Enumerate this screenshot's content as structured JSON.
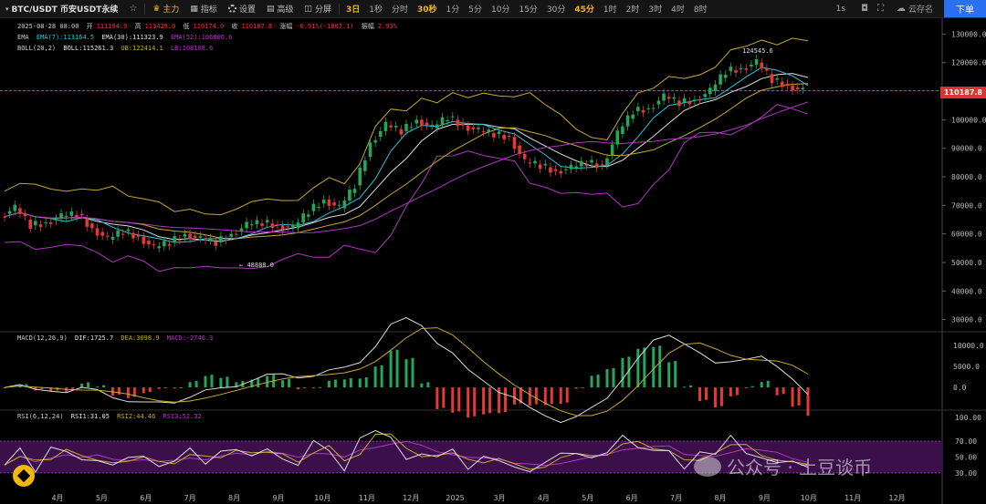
{
  "toolbar": {
    "symbol": "BTC/USDT 币安USDT永续",
    "items": [
      "主力",
      "指标",
      "设置",
      "高级",
      "分屏"
    ],
    "timeframes": [
      "3日",
      "1秒",
      "分时",
      "30秒",
      "1分",
      "5分",
      "10分",
      "15分",
      "30分",
      "45分",
      "1时",
      "2时",
      "3时",
      "4时",
      "8时"
    ],
    "active_timeframes": [
      "3日",
      "30秒",
      "45分"
    ],
    "right_items": [
      "1s",
      "云存名"
    ],
    "order_label": "下单"
  },
  "ohlc": {
    "date": "2025-08-28 08:00",
    "open_label": "开",
    "open": "111194.9",
    "high_label": "高",
    "high": "113429.0",
    "low_label": "低",
    "low": "110174.0",
    "close_label": "收",
    "close": "110187.8",
    "change_label": "涨幅",
    "change": "-0.91%(-1007.1)",
    "amp_label": "振幅",
    "amp": "2.93%"
  },
  "ema": {
    "label": "EMA",
    "ema7": "EMA(7):113164.5",
    "ema30": "EMA(30):111323.9",
    "ema52": "EMA(52):106806.6"
  },
  "boll": {
    "label": "BOLL(20,2)",
    "mid": "BOLL:115261.3",
    "ub": "UB:122414.1",
    "lb": "LB:108108.6"
  },
  "macd": {
    "label": "MACD(12,26,9)",
    "dif": "DIF:1725.7",
    "dea": "DEA:3098.9",
    "macd": "MACD:-2746.3"
  },
  "rsi": {
    "label": "RSI(6,12,24)",
    "rsi1": "RSI1:31.05",
    "rsi2": "RSI2:44.46",
    "rsi3": "RSI3:52.32"
  },
  "current_price": "110187.8",
  "high_marker": "124545.6",
  "low_marker": "48888.0",
  "watermark": "公众号 · 土豆谈币",
  "colors": {
    "up": "#26a65b",
    "down": "#e53935",
    "accent": "#f0b90b",
    "boll": "#c8a832",
    "ema_purple": "#b038c0"
  },
  "chart_data": [
    {
      "type": "line",
      "title": "",
      "x_ticks": [
        "4月",
        "5月",
        "6月",
        "7月",
        "8月",
        "9月",
        "10月",
        "11月",
        "12月",
        "2025",
        "3月",
        "4月",
        "5月",
        "6月",
        "7月",
        "8月",
        "9月",
        "10月",
        "11月",
        "12月"
      ],
      "y_ticks": [
        "130000.0",
        "120000.0",
        "110000.0",
        "100000.0",
        "90000.0",
        "80000.0",
        "70000.0",
        "60000.0",
        "50000.0",
        "40000.0",
        "30000.0"
      ],
      "ylim": [
        27000,
        133000
      ],
      "series": [
        {
          "name": "close",
          "values": [
            66000,
            69000,
            63000,
            64000,
            66000,
            67000,
            62000,
            58000,
            61000,
            59000,
            55000,
            57000,
            60000,
            58000,
            57000,
            60000,
            63000,
            64000,
            63000,
            62000,
            68000,
            72000,
            69000,
            77000,
            92000,
            98000,
            96000,
            100000,
            97000,
            101000,
            98000,
            96000,
            95000,
            94000,
            85000,
            84000,
            82000,
            83000,
            85000,
            84000,
            95000,
            103000,
            104000,
            108000,
            106000,
            107000,
            110000,
            117000,
            118000,
            120000,
            114000,
            112000,
            110000
          ]
        }
      ]
    },
    {
      "type": "bar",
      "title": "",
      "y_ticks": [
        "10000.0",
        "5000.0",
        "0.0"
      ],
      "ylim": [
        -5000,
        12000
      ]
    },
    {
      "type": "line",
      "title": "",
      "y_ticks": [
        "100.00",
        "70.00",
        "50.00",
        "30.00"
      ],
      "ylim": [
        0,
        100
      ]
    }
  ]
}
